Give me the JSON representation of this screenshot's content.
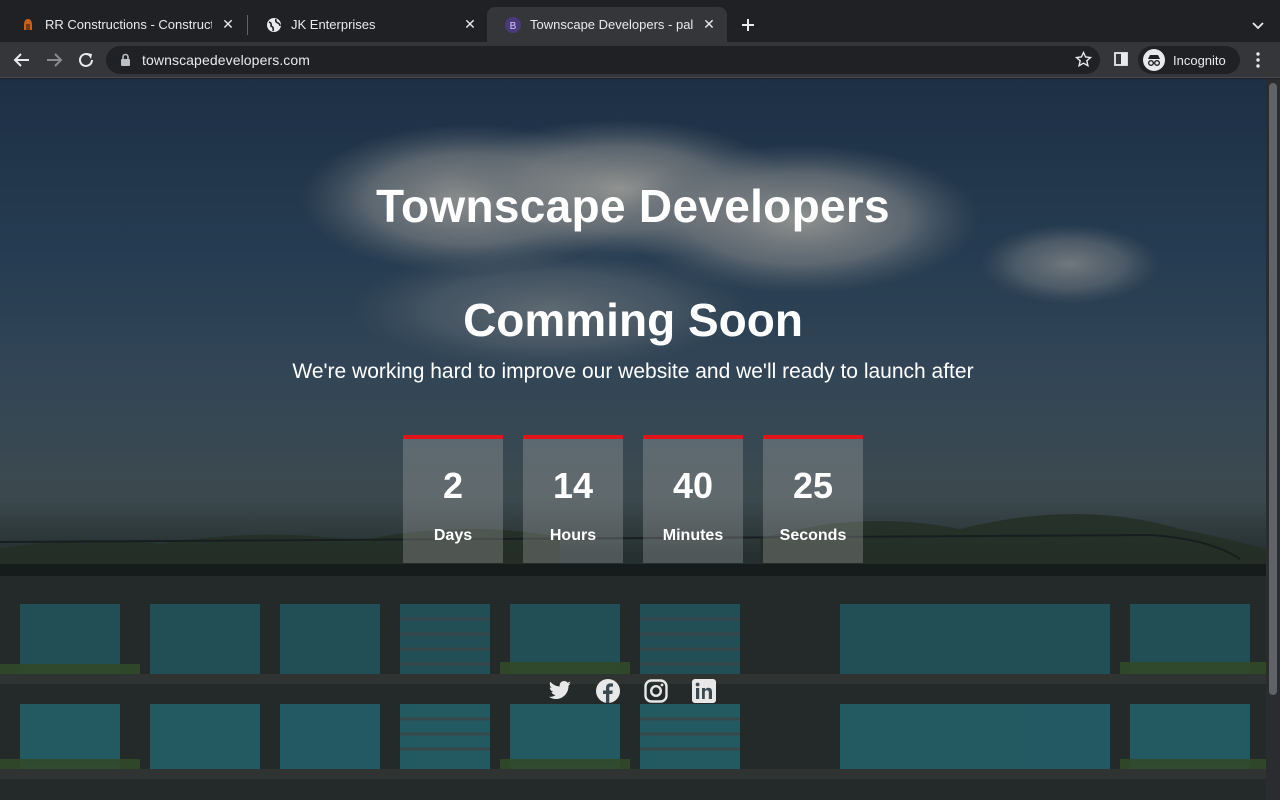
{
  "browser": {
    "tabs": [
      {
        "title": "RR Constructions - Constructio",
        "favicon": "construction-favicon",
        "active": false
      },
      {
        "title": "JK Enterprises",
        "favicon": "globe-icon",
        "active": false
      },
      {
        "title": "Townscape Developers - palan",
        "favicon": "bootstrap-favicon",
        "favicon_letter": "B",
        "active": true
      }
    ],
    "url": "townscapedevelopers.com",
    "incognito_label": "Incognito"
  },
  "page": {
    "brand": "Townscape Developers",
    "headline": "Comming Soon",
    "subline": "We're working hard to improve our website and we'll ready to launch after",
    "countdown": [
      {
        "value": "2",
        "label": "Days"
      },
      {
        "value": "14",
        "label": "Hours"
      },
      {
        "value": "40",
        "label": "Minutes"
      },
      {
        "value": "25",
        "label": "Seconds"
      }
    ],
    "social": [
      "twitter-icon",
      "facebook-icon",
      "instagram-icon",
      "linkedin-icon"
    ]
  },
  "colors": {
    "accent": "#e3131b",
    "chrome_dark": "#202124",
    "chrome_toolbar": "#35363a"
  }
}
